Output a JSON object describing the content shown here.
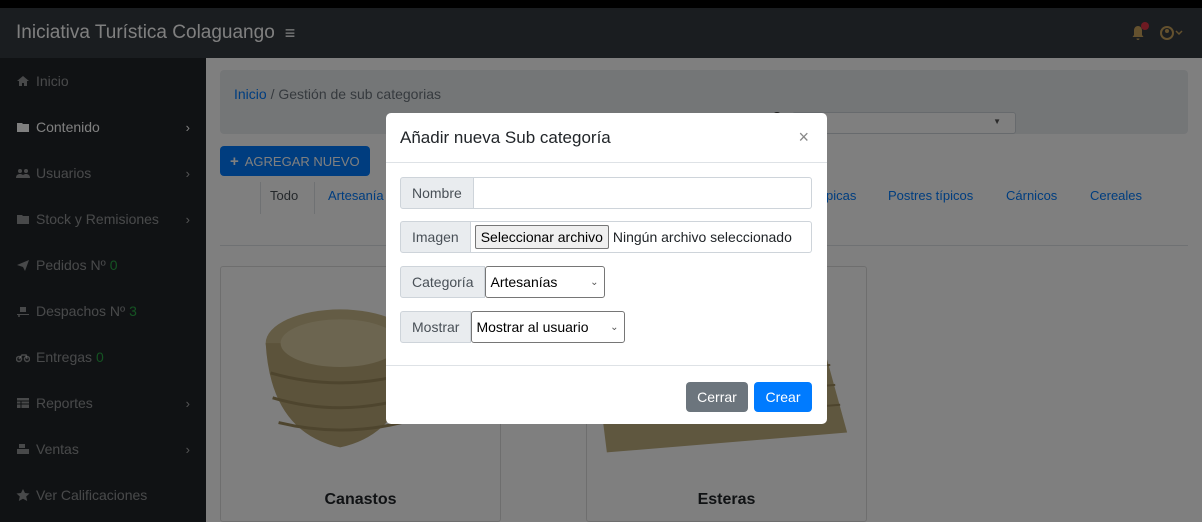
{
  "header": {
    "title": "Iniciativa Turística Colaguango",
    "menu_icon": "≡"
  },
  "sidebar": {
    "items": [
      {
        "label": "Inicio",
        "icon": "home-icon",
        "chevron": "",
        "count": ""
      },
      {
        "label": "Contenido",
        "icon": "folder-icon",
        "chevron": "›",
        "count": ""
      },
      {
        "label": "Usuarios",
        "icon": "users-icon",
        "chevron": "›",
        "count": ""
      },
      {
        "label": "Stock y Remisiones",
        "icon": "folder-icon",
        "chevron": "›",
        "count": ""
      },
      {
        "label": "Pedidos Nº",
        "icon": "send-icon",
        "chevron": "",
        "count": "0"
      },
      {
        "label": "Despachos Nº",
        "icon": "dolly-icon",
        "chevron": "",
        "count": "3"
      },
      {
        "label": "Entregas",
        "icon": "motorcycle-icon",
        "chevron": "",
        "count": "0"
      },
      {
        "label": "Reportes",
        "icon": "table-icon",
        "chevron": "›",
        "count": ""
      },
      {
        "label": "Ventas",
        "icon": "cash-register-icon",
        "chevron": "›",
        "count": ""
      },
      {
        "label": "Ver Calificaciones",
        "icon": "star-icon",
        "chevron": "",
        "count": ""
      }
    ]
  },
  "breadcrumb": {
    "home": "Inicio",
    "separator": "/",
    "current": "Gestión de sub categorias"
  },
  "toolbar": {
    "add_label": "AGREGAR NUEVO"
  },
  "categories": [
    "Todo",
    "Artesanía",
    "picas",
    "Postres típicos",
    "Cárnicos",
    "Cereales"
  ],
  "cards": [
    {
      "title": "Canastos"
    },
    {
      "title": "Esteras"
    }
  ],
  "modal": {
    "title": "Añadir nueva Sub categoría",
    "close": "×",
    "nombre_label": "Nombre",
    "nombre_value": "",
    "imagen_label": "Imagen",
    "file_button": "Seleccionar archivo",
    "file_status": "Ningún archivo seleccionado",
    "categoria_label": "Categoría",
    "categoria_value": "Artesanías",
    "mostrar_label": "Mostrar",
    "mostrar_value": "Mostrar al usuario",
    "cancel_label": "Cerrar",
    "create_label": "Crear"
  },
  "colors": {
    "primary": "#007bff",
    "sidebar": "#212529",
    "navbar": "#343a40",
    "count": "#28a745"
  }
}
